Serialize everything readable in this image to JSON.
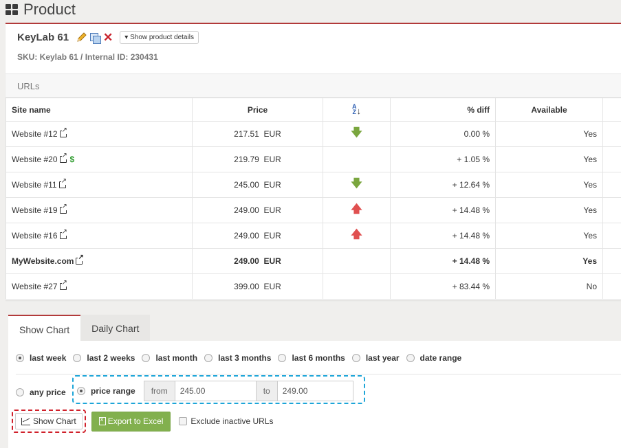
{
  "page": {
    "title": "Product"
  },
  "product": {
    "name": "KeyLab 61",
    "details_button": "Show product details",
    "sku_line": "SKU: Keylab 61 / Internal ID: 230431"
  },
  "urls_section": {
    "title": "URLs"
  },
  "table": {
    "headers": {
      "site": "Site name",
      "price": "Price",
      "diff": "% diff",
      "available": "Available"
    },
    "rows": [
      {
        "site": "Website #12",
        "price": "217.51",
        "currency": "EUR",
        "color": "green",
        "arrow": "down",
        "diff": "0.00 %",
        "available": "Yes"
      },
      {
        "site": "Website #20",
        "price": "219.79",
        "currency": "EUR",
        "color": "normal",
        "arrow": "",
        "diff": "+ 1.05 %",
        "available": "Yes",
        "dollar": "$"
      },
      {
        "site": "Website #11",
        "price": "245.00",
        "currency": "EUR",
        "color": "green",
        "arrow": "down",
        "diff": "+ 12.64 %",
        "available": "Yes"
      },
      {
        "site": "Website #19",
        "price": "249.00",
        "currency": "EUR",
        "color": "red",
        "arrow": "up",
        "diff": "+ 14.48 %",
        "available": "Yes"
      },
      {
        "site": "Website #16",
        "price": "249.00",
        "currency": "EUR",
        "color": "red",
        "arrow": "up",
        "diff": "+ 14.48 %",
        "available": "Yes"
      },
      {
        "site": "MyWebsite.com",
        "price": "249.00",
        "currency": "EUR",
        "color": "normal",
        "arrow": "",
        "diff": "+ 14.48 %",
        "available": "Yes",
        "bold": true
      },
      {
        "site": "Website #27",
        "price": "399.00",
        "currency": "EUR",
        "color": "normal",
        "arrow": "",
        "diff": "+ 83.44 %",
        "available": "No"
      }
    ]
  },
  "tabs": [
    {
      "label": "Show Chart"
    },
    {
      "label": "Daily Chart"
    }
  ],
  "periods": [
    {
      "label": "last week",
      "checked": true
    },
    {
      "label": "last 2 weeks",
      "checked": false
    },
    {
      "label": "last month",
      "checked": false
    },
    {
      "label": "last 3 months",
      "checked": false
    },
    {
      "label": "last 6 months",
      "checked": false
    },
    {
      "label": "last year",
      "checked": false
    },
    {
      "label": "date range",
      "checked": false
    }
  ],
  "price_filter": {
    "any_label": "any price",
    "range_label": "price range",
    "from_label": "from",
    "from_value": "245.00",
    "to_label": "to",
    "to_value": "249.00"
  },
  "actions": {
    "show_chart": "Show Chart",
    "export": "Export to Excel",
    "exclude_inactive": "Exclude inactive URLs"
  },
  "colors": {
    "accent": "#b23a3a",
    "green": "#7aa63e",
    "red": "#e05050",
    "success_button": "#82b04e",
    "highlight_blue": "#1da5d8",
    "highlight_red": "#d0202a"
  }
}
